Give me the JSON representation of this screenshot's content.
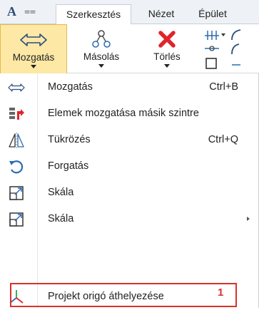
{
  "tabs": [
    "Szerkesztés",
    "Nézet",
    "Épület"
  ],
  "ribbon": {
    "move_label": "Mozgatás",
    "copy_label": "Másolás",
    "delete_label": "Törlés"
  },
  "menu": {
    "items": [
      {
        "label": "Mozgatás",
        "shortcut": "Ctrl+B",
        "icon": "move-arrows-icon"
      },
      {
        "label": "Elemek mozgatása másik szintre",
        "shortcut": "",
        "icon": "move-to-level-icon"
      },
      {
        "label": "Tükrözés",
        "shortcut": "Ctrl+Q",
        "icon": "mirror-icon"
      },
      {
        "label": "Forgatás",
        "shortcut": "",
        "icon": "rotate-icon"
      },
      {
        "label": "Skála",
        "shortcut": "",
        "icon": "scale-icon"
      },
      {
        "label": "Skála",
        "shortcut": "",
        "icon": "scale-icon",
        "has_submenu": true
      },
      {
        "label": "Projekt origó áthelyezése",
        "shortcut": "",
        "icon": "origin-axes-icon"
      }
    ]
  },
  "callout": "1",
  "colors": {
    "selected_bg": "#fde8a6",
    "selected_border": "#e6b94c",
    "highlight_red": "#d9312b",
    "icon_blue": "#2b6cb0",
    "delete_red": "#e0242a"
  }
}
